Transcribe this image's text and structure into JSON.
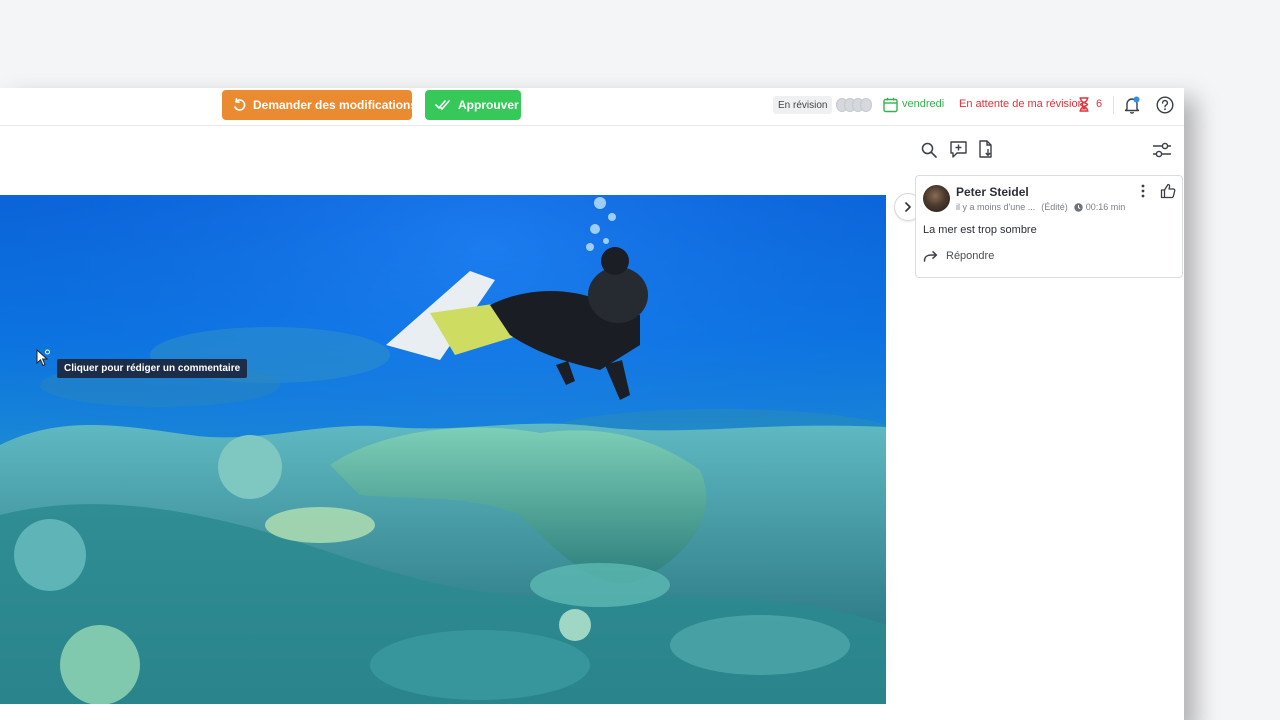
{
  "topbar": {
    "request_changes_label": "Demander des modifications",
    "approve_label": "Approuver",
    "status": "En révision",
    "due_date": "vendredi",
    "waiting_label": "En attente de ma révision",
    "waiting_count": "6",
    "icons": [
      "undo-arrow-icon",
      "double-check-icon",
      "calendar-icon",
      "hourglass-icon",
      "bell-icon",
      "help-icon"
    ]
  },
  "colors": {
    "request_changes": "#ea8b32",
    "approve": "#36c95a",
    "due_date": "#36b14f",
    "waiting": "#e0323c",
    "tooltip": "#1c2d4a"
  },
  "video": {
    "tooltip": "Cliquer pour rédiger un commentaire"
  },
  "sidebar": {
    "toolbar_icons": [
      "search-icon",
      "add-comment-icon",
      "document-download-icon",
      "filter-sliders-icon"
    ],
    "comment": {
      "author": "Peter Steidel",
      "time_ago": "il y a moins d'une ...",
      "edited": "(Édité)",
      "timecode": "00:16 min",
      "text": "La mer est trop sombre",
      "reply_label": "Répondre"
    }
  }
}
